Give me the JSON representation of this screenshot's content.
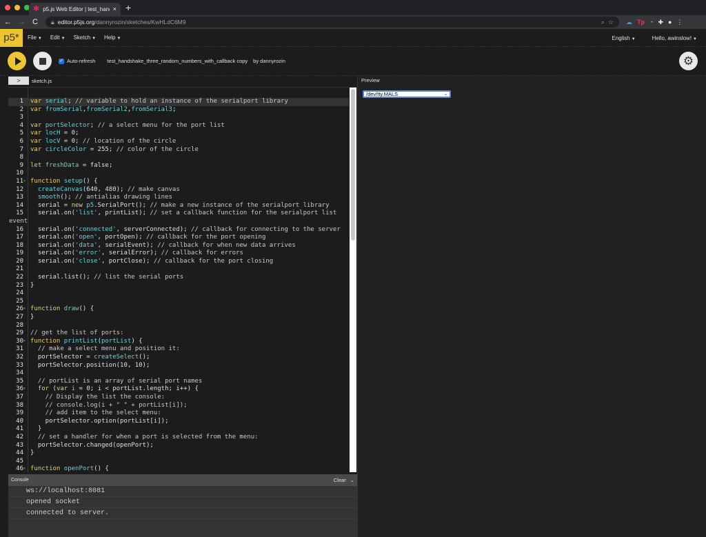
{
  "browser": {
    "tab_title": "p5.js Web Editor | test_handsh",
    "tab_close": "×",
    "new_tab": "+",
    "url_host": "editor.p5js.org",
    "url_path": "/dannyrozin/sketches/KwHLdC6M9",
    "nav": {
      "back": "←",
      "forward": "→",
      "reload": "C"
    },
    "traffic_colors": [
      "#ff5f57",
      "#febc2e",
      "#28c840"
    ]
  },
  "menubar": {
    "logo": "p5*",
    "items": [
      {
        "label": "File"
      },
      {
        "label": "Edit"
      },
      {
        "label": "Sketch"
      },
      {
        "label": "Help"
      }
    ],
    "language": "English",
    "user": "Hello, awinslow!"
  },
  "toolbar": {
    "autorefresh_label": "Auto-refresh",
    "autorefresh_checked": true,
    "project_name": "test_handshake_three_random_numbers_with_callback copy",
    "byline": "by dannyrozin"
  },
  "editor": {
    "file_name": "sketch.js",
    "expand_glyph": ">",
    "lines": [
      {
        "n": "1",
        "active": true,
        "tokens": [
          [
            "kw",
            "var "
          ],
          [
            "fn",
            "serial"
          ],
          [
            "plain",
            "; "
          ],
          [
            "cm",
            "// variable to hold an instance of the serialport library"
          ]
        ]
      },
      {
        "n": "2",
        "tokens": [
          [
            "kw",
            "var "
          ],
          [
            "fn",
            "fromSerial"
          ],
          [
            "plain",
            ","
          ],
          [
            "fn",
            "fromSerial2"
          ],
          [
            "plain",
            ","
          ],
          [
            "fn",
            "fromSerial3"
          ],
          [
            "plain",
            ";"
          ]
        ]
      },
      {
        "n": "3",
        "tokens": []
      },
      {
        "n": "4",
        "tokens": [
          [
            "kw",
            "var "
          ],
          [
            "fn",
            "portSelector"
          ],
          [
            "plain",
            "; "
          ],
          [
            "cm",
            "// a select menu for the port list"
          ]
        ]
      },
      {
        "n": "5",
        "tokens": [
          [
            "kw",
            "var "
          ],
          [
            "fn",
            "locH"
          ],
          [
            "plain",
            " = 0;"
          ]
        ]
      },
      {
        "n": "6",
        "tokens": [
          [
            "kw",
            "var "
          ],
          [
            "fn",
            "locV"
          ],
          [
            "plain",
            " = 0; "
          ],
          [
            "cm",
            "// location of the circle"
          ]
        ]
      },
      {
        "n": "7",
        "tokens": [
          [
            "kw",
            "var "
          ],
          [
            "fn",
            "circleColor"
          ],
          [
            "plain",
            " = 255; "
          ],
          [
            "cm",
            "// color of the circle"
          ]
        ]
      },
      {
        "n": "8",
        "tokens": []
      },
      {
        "n": "9",
        "tokens": [
          [
            "kw",
            "let "
          ],
          [
            "fn",
            "freshData"
          ],
          [
            "plain",
            " = false;"
          ]
        ]
      },
      {
        "n": "10",
        "tokens": []
      },
      {
        "n": "11",
        "fold": true,
        "tokens": [
          [
            "kw",
            "function "
          ],
          [
            "fn",
            "setup"
          ],
          [
            "plain",
            "() {"
          ]
        ]
      },
      {
        "n": "12",
        "tokens": [
          [
            "plain",
            "  "
          ],
          [
            "fn",
            "createCanvas"
          ],
          [
            "plain",
            "(640, 480); "
          ],
          [
            "cm",
            "// make canvas"
          ]
        ]
      },
      {
        "n": "13",
        "tokens": [
          [
            "plain",
            "  "
          ],
          [
            "fn",
            "smooth"
          ],
          [
            "plain",
            "(); "
          ],
          [
            "cm",
            "// antialias drawing lines"
          ]
        ]
      },
      {
        "n": "14",
        "tokens": [
          [
            "plain",
            "  serial = "
          ],
          [
            "kw",
            "new "
          ],
          [
            "fn",
            "p5"
          ],
          [
            "plain",
            ".SerialPort(); "
          ],
          [
            "cm",
            "// make a new instance of the serialport library"
          ]
        ]
      },
      {
        "n": "15",
        "tokens": [
          [
            "plain",
            "  serial.on("
          ],
          [
            "str",
            "'list'"
          ],
          [
            "plain",
            ", printList); "
          ],
          [
            "cm",
            "// set a callback function for the serialport list"
          ]
        ]
      },
      {
        "n": "",
        "tokens": [
          [
            "cm",
            "event"
          ]
        ],
        "wrap": true
      },
      {
        "n": "16",
        "tokens": [
          [
            "plain",
            "  serial.on("
          ],
          [
            "str",
            "'connected'"
          ],
          [
            "plain",
            ", serverConnected); "
          ],
          [
            "cm",
            "// callback for connecting to the server"
          ]
        ]
      },
      {
        "n": "17",
        "tokens": [
          [
            "plain",
            "  serial.on("
          ],
          [
            "str",
            "'open'"
          ],
          [
            "plain",
            ", portOpen); "
          ],
          [
            "cm",
            "// callback for the port opening"
          ]
        ]
      },
      {
        "n": "18",
        "tokens": [
          [
            "plain",
            "  serial.on("
          ],
          [
            "str",
            "'data'"
          ],
          [
            "plain",
            ", serialEvent); "
          ],
          [
            "cm",
            "// callback for when new data arrives"
          ]
        ]
      },
      {
        "n": "19",
        "tokens": [
          [
            "plain",
            "  serial.on("
          ],
          [
            "str",
            "'error'"
          ],
          [
            "plain",
            ", serialError); "
          ],
          [
            "cm",
            "// callback for errors"
          ]
        ]
      },
      {
        "n": "20",
        "tokens": [
          [
            "plain",
            "  serial.on("
          ],
          [
            "str",
            "'close'"
          ],
          [
            "plain",
            ", portClose); "
          ],
          [
            "cm",
            "// callback for the port closing"
          ]
        ]
      },
      {
        "n": "21",
        "tokens": []
      },
      {
        "n": "22",
        "tokens": [
          [
            "plain",
            "  serial.list(); "
          ],
          [
            "cm",
            "// list the serial ports"
          ]
        ]
      },
      {
        "n": "23",
        "tokens": [
          [
            "plain",
            "}"
          ]
        ]
      },
      {
        "n": "24",
        "tokens": []
      },
      {
        "n": "25",
        "tokens": []
      },
      {
        "n": "26",
        "fold": true,
        "tokens": [
          [
            "kw",
            "function "
          ],
          [
            "fn",
            "draw"
          ],
          [
            "plain",
            "() {"
          ]
        ]
      },
      {
        "n": "27",
        "tokens": [
          [
            "plain",
            "}"
          ]
        ]
      },
      {
        "n": "28",
        "tokens": []
      },
      {
        "n": "29",
        "tokens": [
          [
            "cm",
            "// get the list of ports:"
          ]
        ]
      },
      {
        "n": "30",
        "fold": true,
        "tokens": [
          [
            "kw",
            "function "
          ],
          [
            "fn",
            "printList"
          ],
          [
            "plain",
            "("
          ],
          [
            "fn",
            "portList"
          ],
          [
            "plain",
            ") {"
          ]
        ]
      },
      {
        "n": "31",
        "tokens": [
          [
            "cm",
            "  // make a select menu and position it:"
          ]
        ]
      },
      {
        "n": "32",
        "tokens": [
          [
            "plain",
            "  portSelector = "
          ],
          [
            "fn",
            "createSelect"
          ],
          [
            "plain",
            "();"
          ]
        ]
      },
      {
        "n": "33",
        "tokens": [
          [
            "plain",
            "  portSelector.position(10, 10);"
          ]
        ]
      },
      {
        "n": "34",
        "tokens": []
      },
      {
        "n": "35",
        "tokens": [
          [
            "cm",
            "  // portList is an array of serial port names"
          ]
        ]
      },
      {
        "n": "36",
        "fold": true,
        "tokens": [
          [
            "plain",
            "  "
          ],
          [
            "kw",
            "for "
          ],
          [
            "plain",
            "("
          ],
          [
            "kw",
            "var "
          ],
          [
            "fn",
            "i"
          ],
          [
            "plain",
            " = 0; i < portList.length; i++) {"
          ]
        ]
      },
      {
        "n": "37",
        "tokens": [
          [
            "cm",
            "    // Display the list the console:"
          ]
        ]
      },
      {
        "n": "38",
        "tokens": [
          [
            "cm",
            "    // console.log(i + \" \" + portList[i]);"
          ]
        ]
      },
      {
        "n": "39",
        "tokens": [
          [
            "cm",
            "    // add item to the select menu:"
          ]
        ]
      },
      {
        "n": "40",
        "tokens": [
          [
            "plain",
            "    portSelector.option(portList[i]);"
          ]
        ]
      },
      {
        "n": "41",
        "tokens": [
          [
            "plain",
            "  }"
          ]
        ]
      },
      {
        "n": "42",
        "tokens": [
          [
            "cm",
            "  // set a handler for when a port is selected from the menu:"
          ]
        ]
      },
      {
        "n": "43",
        "tokens": [
          [
            "plain",
            "  portSelector.changed(openPort);"
          ]
        ]
      },
      {
        "n": "44",
        "tokens": [
          [
            "plain",
            "}"
          ]
        ]
      },
      {
        "n": "45",
        "tokens": []
      },
      {
        "n": "46",
        "fold": true,
        "tokens": [
          [
            "kw",
            "function "
          ],
          [
            "fn",
            "openPort"
          ],
          [
            "plain",
            "() {"
          ]
        ]
      }
    ]
  },
  "console": {
    "title": "Console",
    "clear_label": "Clear",
    "lines": [
      "ws://localhost:8081",
      "opened socket",
      "connected to server."
    ]
  },
  "preview": {
    "label": "Preview",
    "port_selected": "/dev/tty.MALS"
  }
}
